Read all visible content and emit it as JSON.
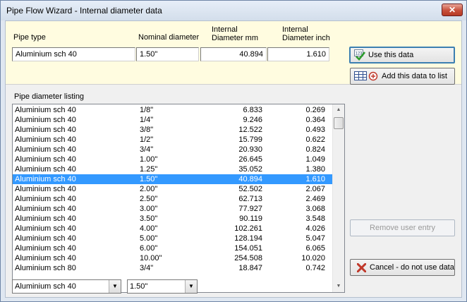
{
  "window": {
    "title": "Pipe Flow Wizard - Internal diameter data",
    "close_label": "✕"
  },
  "headers": {
    "pipe_type": "Pipe type",
    "nominal_diameter": "Nominal diameter",
    "internal_mm_line1": "Internal",
    "internal_mm_line2": "Diameter  mm",
    "internal_inch_line1": "Internal",
    "internal_inch_line2": "Diameter inch"
  },
  "current": {
    "pipe_type": "Aluminium sch 40",
    "nominal": "1.50\"",
    "mm": "40.894",
    "inch": "1.610"
  },
  "buttons": {
    "use": "Use this data",
    "add": "Add this data to list",
    "remove": "Remove user entry",
    "cancel": "Cancel - do not use data"
  },
  "listing": {
    "label": "Pipe diameter listing",
    "selected_index": 7,
    "rows": [
      {
        "type": "Aluminium sch 40",
        "nominal": "1/8\"",
        "mm": "6.833",
        "inch": "0.269"
      },
      {
        "type": "Aluminium sch 40",
        "nominal": "1/4\"",
        "mm": "9.246",
        "inch": "0.364"
      },
      {
        "type": "Aluminium sch 40",
        "nominal": "3/8\"",
        "mm": "12.522",
        "inch": "0.493"
      },
      {
        "type": "Aluminium sch 40",
        "nominal": "1/2\"",
        "mm": "15.799",
        "inch": "0.622"
      },
      {
        "type": "Aluminium sch 40",
        "nominal": "3/4\"",
        "mm": "20.930",
        "inch": "0.824"
      },
      {
        "type": "Aluminium sch 40",
        "nominal": "1.00\"",
        "mm": "26.645",
        "inch": "1.049"
      },
      {
        "type": "Aluminium sch 40",
        "nominal": "1.25\"",
        "mm": "35.052",
        "inch": "1.380"
      },
      {
        "type": "Aluminium sch 40",
        "nominal": "1.50\"",
        "mm": "40.894",
        "inch": "1.610"
      },
      {
        "type": "Aluminium sch 40",
        "nominal": "2.00\"",
        "mm": "52.502",
        "inch": "2.067"
      },
      {
        "type": "Aluminium sch 40",
        "nominal": "2.50\"",
        "mm": "62.713",
        "inch": "2.469"
      },
      {
        "type": "Aluminium sch 40",
        "nominal": "3.00\"",
        "mm": "77.927",
        "inch": "3.068"
      },
      {
        "type": "Aluminium sch 40",
        "nominal": "3.50\"",
        "mm": "90.119",
        "inch": "3.548"
      },
      {
        "type": "Aluminium sch 40",
        "nominal": "4.00\"",
        "mm": "102.261",
        "inch": "4.026"
      },
      {
        "type": "Aluminium sch 40",
        "nominal": "5.00\"",
        "mm": "128.194",
        "inch": "5.047"
      },
      {
        "type": "Aluminium sch 40",
        "nominal": "6.00\"",
        "mm": "154.051",
        "inch": "6.065"
      },
      {
        "type": "Aluminium sch 40",
        "nominal": "10.00\"",
        "mm": "254.508",
        "inch": "10.020"
      },
      {
        "type": "Aluminium sch 80",
        "nominal": "3/4\"",
        "mm": "18.847",
        "inch": "0.742"
      }
    ]
  },
  "filters": {
    "pipe_type": "Aluminium sch 40",
    "nominal": "1.50\""
  },
  "icons": {
    "use": "checkmark-icon",
    "add": "grid-add-icon",
    "cancel": "red-x-icon"
  },
  "colors": {
    "selection": "#3399ff",
    "top_panel": "#fffce0",
    "cancel_x": "#c0392b"
  }
}
